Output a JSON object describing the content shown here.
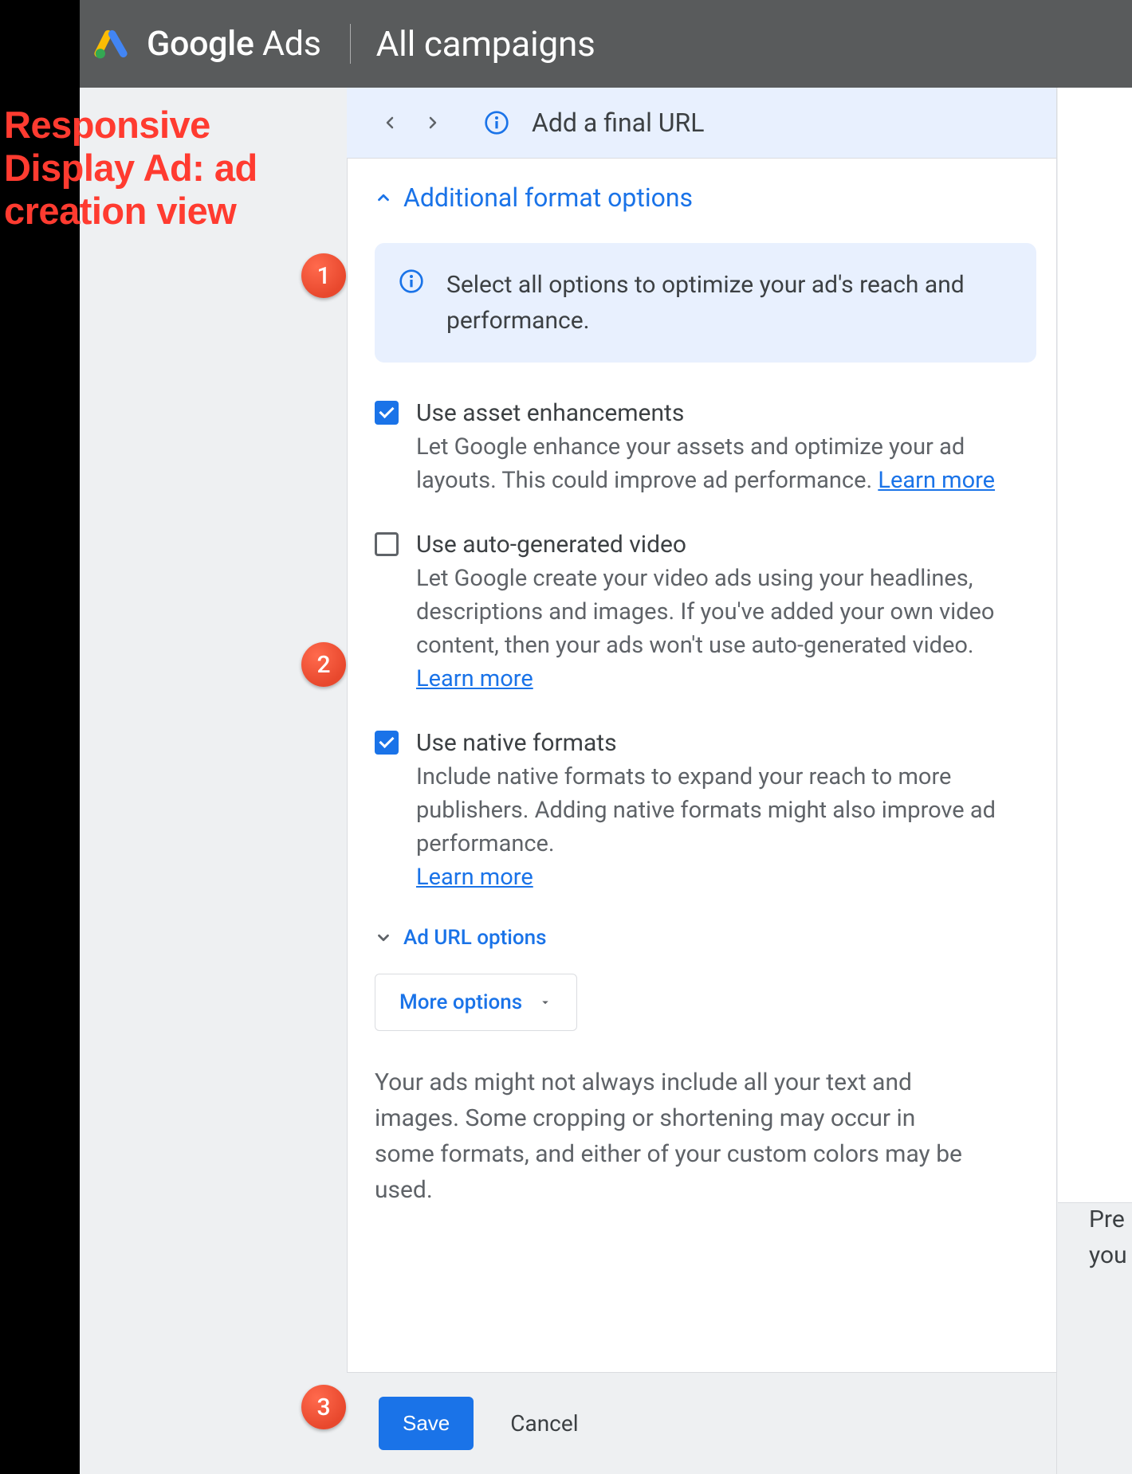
{
  "annotation": "Responsive Display Ad: ad creation view",
  "header": {
    "product_g": "Google",
    "product_a": " Ads",
    "title": "All campaigns"
  },
  "banner": {
    "text": "Add a final URL"
  },
  "section": {
    "expand_label": "Additional format options",
    "info_box": "Select all options to optimize your ad's reach and performance.",
    "options": [
      {
        "checked": true,
        "title": "Use asset enhancements",
        "desc": "Let Google enhance your assets and optimize your ad layouts. This could improve ad performance. ",
        "learnmore": "Learn more"
      },
      {
        "checked": false,
        "title": "Use auto-generated video",
        "desc": "Let Google create your video ads using your headlines, descriptions and images. If you've added your own video content, then your ads won't use auto-generated video. ",
        "learnmore": "Learn more"
      },
      {
        "checked": true,
        "title": "Use native formats",
        "desc": "Include native formats to expand your reach to more publishers. Adding native formats might also improve ad performance. ",
        "learnmore": "Learn more"
      }
    ],
    "ad_url_label": "Ad URL options",
    "more_options": "More options",
    "disclaimer": "Your ads might not always include all your text and images. Some cropping or shortening may occur in some formats, and either of your custom colors may be used."
  },
  "preview_text_1": "Pre",
  "preview_text_2": "you",
  "footer": {
    "save": "Save",
    "cancel": "Cancel"
  },
  "markers": [
    "1",
    "2",
    "3"
  ]
}
